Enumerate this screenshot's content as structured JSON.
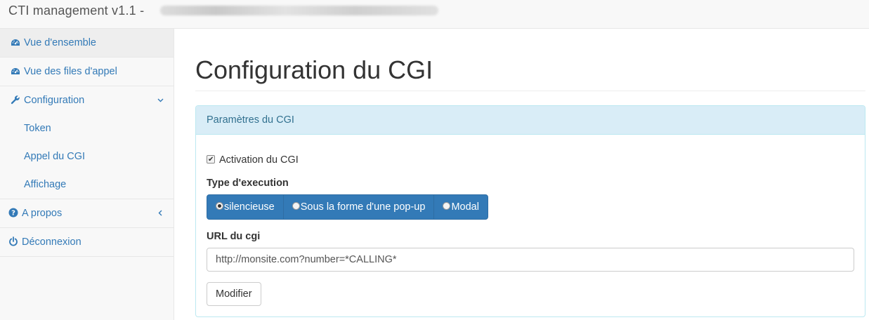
{
  "navbar": {
    "brand": "CTI management v1.1 -"
  },
  "sidebar": {
    "items": [
      {
        "label": "Vue d'ensemble",
        "icon": "dashboard-icon"
      },
      {
        "label": "Vue des files d'appel",
        "icon": "dashboard-icon"
      },
      {
        "label": "Configuration",
        "icon": "wrench-icon",
        "caret": "chevron-down-icon"
      },
      {
        "label": "A propos",
        "icon": "question-circle-icon",
        "caret": "chevron-left-icon"
      },
      {
        "label": "Déconnexion",
        "icon": "power-icon"
      }
    ],
    "subitems": [
      {
        "label": "Token"
      },
      {
        "label": "Appel du CGI"
      },
      {
        "label": "Affichage"
      }
    ]
  },
  "main": {
    "title": "Configuration du CGI",
    "panel": {
      "heading": "Paramètres du CGI",
      "activation_label": "Activation du CGI",
      "activation_checked": true,
      "exec_type_label": "Type d'execution",
      "exec_options": [
        "silencieuse",
        "Sous la forme d'une pop-up",
        "Modal"
      ],
      "exec_selected": "silencieuse",
      "url_label": "URL du cgi",
      "url_value": "http://monsite.com?number=*CALLING*",
      "submit_label": "Modifier"
    }
  },
  "colors": {
    "link": "#337ab7",
    "panel_heading_bg": "#d9edf7",
    "panel_border": "#bce8f1",
    "button_primary": "#337ab7"
  }
}
